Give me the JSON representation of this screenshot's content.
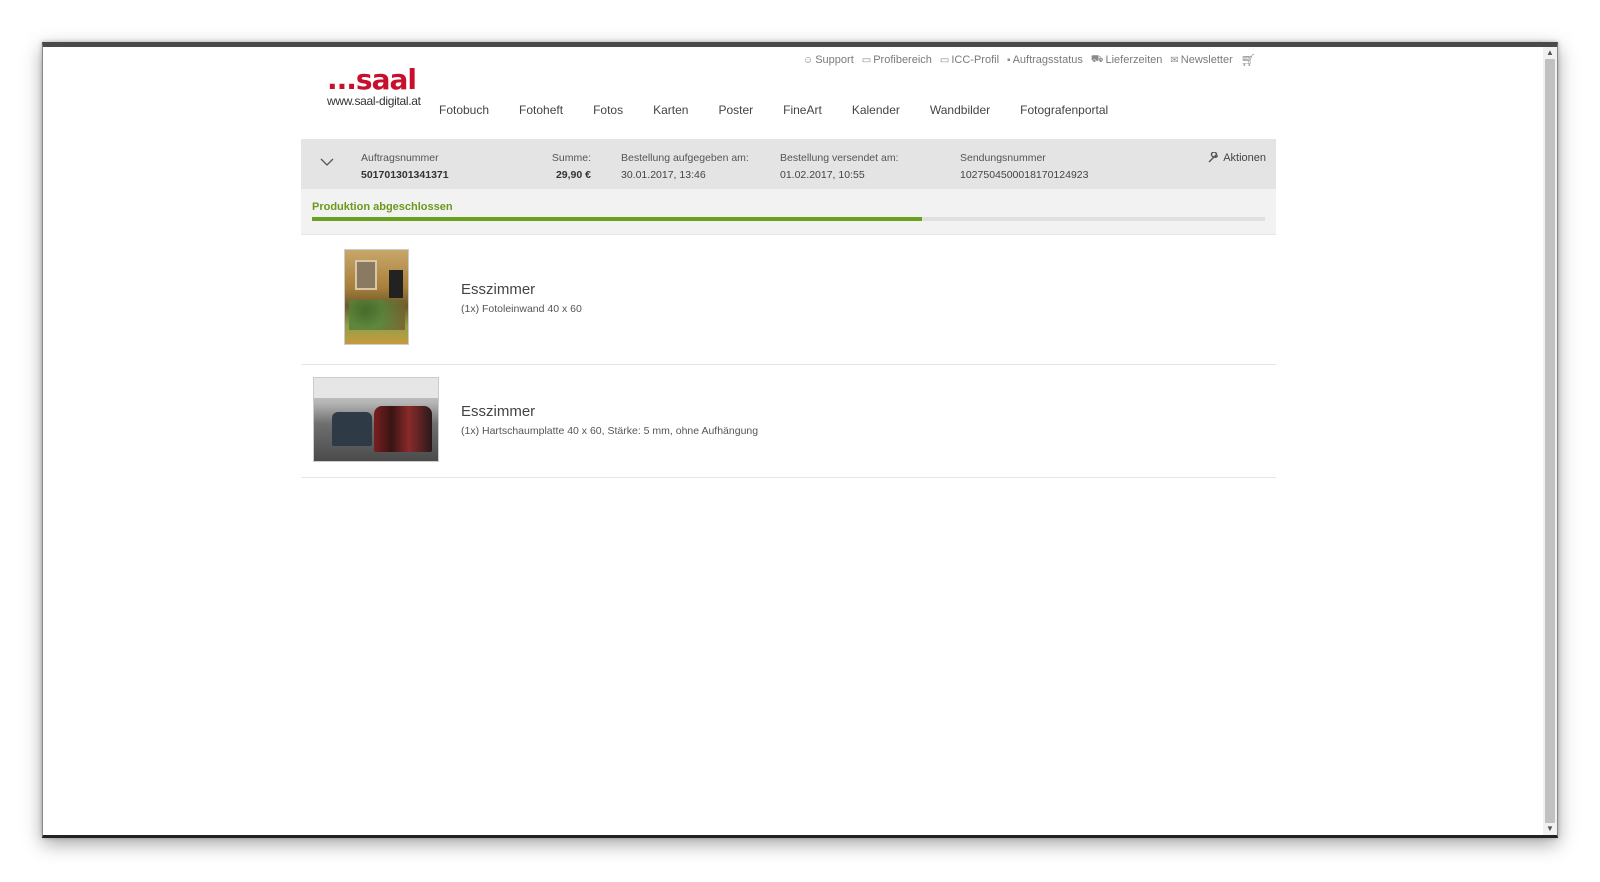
{
  "topnav": {
    "items": [
      {
        "label": "Support",
        "icon": "support-icon"
      },
      {
        "label": "Profibereich",
        "icon": "profi-icon"
      },
      {
        "label": "ICC-Profil",
        "icon": "icc-icon"
      },
      {
        "label": "Auftragsstatus",
        "icon": "status-icon"
      },
      {
        "label": "Lieferzeiten",
        "icon": "truck-icon"
      },
      {
        "label": "Newsletter",
        "icon": "mail-icon"
      }
    ],
    "cart_icon": "cart-icon"
  },
  "logo": {
    "brand": "...saal",
    "url": "www.saal-digital.at"
  },
  "mainnav": [
    "Fotobuch",
    "Fotoheft",
    "Fotos",
    "Karten",
    "Poster",
    "FineArt",
    "Kalender",
    "Wandbilder",
    "Fotografenportal"
  ],
  "order": {
    "number_label": "Auftragsnummer",
    "number": "501701301341371",
    "sum_label": "Summe:",
    "sum": "29,90 €",
    "placed_label": "Bestellung aufgegeben am:",
    "placed": "30.01.2017, 13:46",
    "shipped_label": "Bestellung versendet am:",
    "shipped": "01.02.2017, 10:55",
    "tracking_label": "Sendungsnummer",
    "tracking": "1027504500018170124923",
    "actions_label": "Aktionen"
  },
  "progress": {
    "label": "Produktion abgeschlossen",
    "fraction": 0.64
  },
  "items": [
    {
      "title": "Esszimmer",
      "desc": "(1x) Fotoleinwand 40 x 60"
    },
    {
      "title": "Esszimmer",
      "desc": "(1x) Hartschaumplatte 40 x 60, Stärke: 5 mm, ohne Aufhängung"
    }
  ],
  "colors": {
    "brand": "#c8102e",
    "progress": "#6aa01f",
    "bar": "#e4e4e4"
  }
}
